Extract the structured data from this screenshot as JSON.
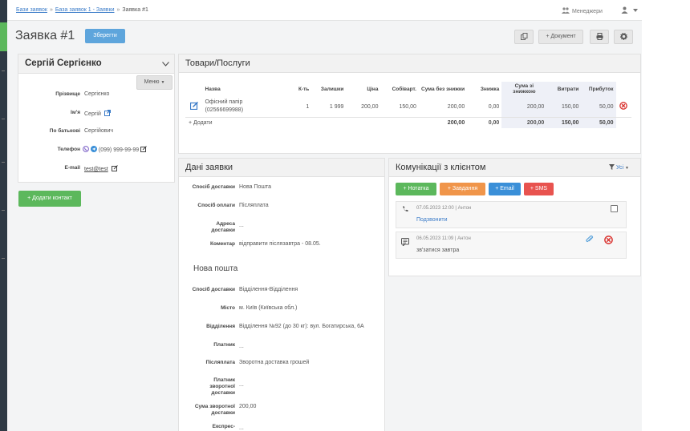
{
  "breadcrumbs": [
    "Бази заявок",
    "База заявок 1 - Заявки",
    "Заявка #1"
  ],
  "header": {
    "managers_label": "Менеджери"
  },
  "page": {
    "title": "Заявка #1",
    "save_label": "Зберегти",
    "document_label": "+ Документ"
  },
  "contact": {
    "name": "Сергій Сергієнко",
    "menu_label": "Меню",
    "fields": {
      "surname_label": "Прізвище",
      "surname": "Сергієнко",
      "firstname_label": "Ім'я",
      "firstname": "Сергій",
      "patronymic_label": "По батькові",
      "patronymic": "Сергійович",
      "phone_label": "Телефон",
      "phone": "(099) 999-99-99",
      "email_label": "E-mail",
      "email": "test@test"
    },
    "add_contact_label": "+ Додати контакт"
  },
  "goods": {
    "title": "Товари/Послуги",
    "columns": [
      "Назва",
      "К-ть",
      "Залишки",
      "Ціна",
      "Собіварт.",
      "Сума без знижки",
      "Знижка",
      "Сума зі знижкою",
      "Витрати",
      "Прибуток"
    ],
    "row": {
      "name_line1": "Офісний папір",
      "name_line2": "(02566699988)",
      "qty": "1",
      "stock": "1 999",
      "price": "200,00",
      "cost": "150,00",
      "sum": "200,00",
      "discount": "0,00",
      "sum_disc": "200,00",
      "expenses": "150,00",
      "profit": "50,00"
    },
    "add_label": "+ Додати",
    "totals": {
      "sum": "200,00",
      "discount": "0,00",
      "sum_disc": "200,00",
      "expenses": "150,00",
      "profit": "50,00"
    }
  },
  "order": {
    "title": "Дані заявки",
    "delivery_label": "Спосіб доставки",
    "delivery": "Нова Пошта",
    "payment_label": "Спосіб оплати",
    "payment": "Післяплата",
    "address_label1": "Адреса",
    "address_label2": "доставки",
    "address": "...",
    "comment_label": "Коментар",
    "comment": "відправити післязавтра - 08.05.",
    "np_title": "Нова пошта",
    "np_method_label": "Спосіб доставки",
    "np_method": "Відділення-Відділення",
    "city_label": "Місто",
    "city": "м. Київ (Київська обл.)",
    "branch_label": "Відділення",
    "branch": "Відділення №92 (до 30 кг): вул. Богатирська, 6А",
    "payer_label": "Платник",
    "payer": "...",
    "cod_label": "Післяплата",
    "cod": "Зворотна доставка грошей",
    "ret_payer_label1": "Платник",
    "ret_payer_label2": "зворотної",
    "ret_payer_label3": "доставки",
    "ret_payer": "...",
    "ret_sum_label1": "Сума зворотної",
    "ret_sum_label2": "доставки",
    "ret_sum": "200,00",
    "express_label": "Експрес-",
    "express": "..."
  },
  "comms": {
    "title": "Комунікації з клієнтом",
    "filter_label": "Усі",
    "btn_note": "+ Нотатка",
    "btn_task": "+ Завдання",
    "btn_email": "+ Email",
    "btn_sms": "+ SMS",
    "items": [
      {
        "meta": "07.05.2023 12:00 | Антон",
        "text": "Подзвонити"
      },
      {
        "meta": "06.05.2023 11:09 | Антон",
        "text": "зв'затися завтра"
      }
    ]
  },
  "colors": {
    "accent": "#5ea5dc",
    "green": "#5cb85c",
    "orange": "#f0954a",
    "blue": "#3a8fd8",
    "red": "#e8534f"
  }
}
